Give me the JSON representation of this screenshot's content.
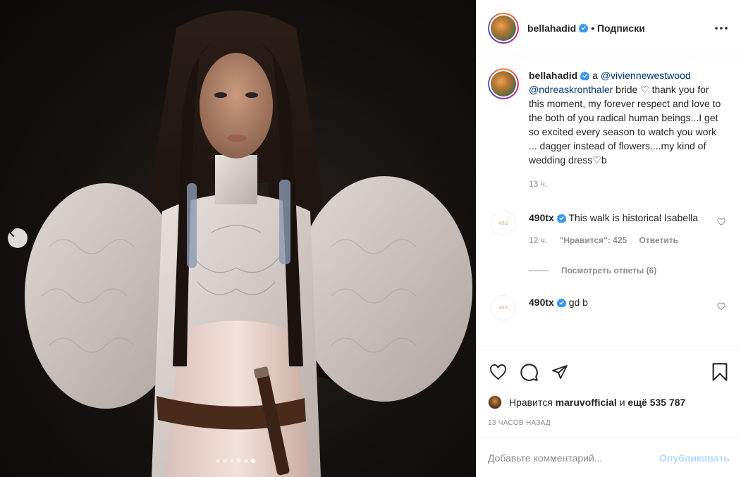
{
  "post": {
    "username": "bellahadid",
    "follow_state": "• Подписки"
  },
  "caption": {
    "username": "bellahadid",
    "prefix": "a",
    "mention1": "@viviennewestwood",
    "mention2": "@ndreaskronthaler",
    "text_after_mentions": "bride ♡ thank you for this moment, my forever respect and love to the both of you radical human beings...I get so excited every season to watch you work ... dagger instead of flowers....my kind of wedding dress♡b",
    "time": "13 ч."
  },
  "comments": [
    {
      "username": "490tx",
      "avatar_text": "49Δ",
      "text": "This walk is historical Isabella",
      "time": "12 ч.",
      "likes": "\"Нравится\": 425",
      "reply_label": "Ответить"
    },
    {
      "username": "490tx",
      "avatar_text": "49Δ",
      "text": "gd b"
    }
  ],
  "view_replies": "Посмотреть ответы (6)",
  "likes": {
    "prefix": "Нравится",
    "user": "maruvofficial",
    "joiner": "и",
    "count": "ещё 535 787"
  },
  "posted_ago": "13 ЧАСОВ НАЗАД",
  "add_comment": {
    "placeholder": "Добавьте комментарий...",
    "publish_label": "Опубликовать"
  },
  "carousel": {
    "total": 6,
    "active_index": 5
  },
  "colors": {
    "verified": "#3897f0",
    "mention": "#00376b",
    "publish_disabled": "#b3dbff"
  }
}
